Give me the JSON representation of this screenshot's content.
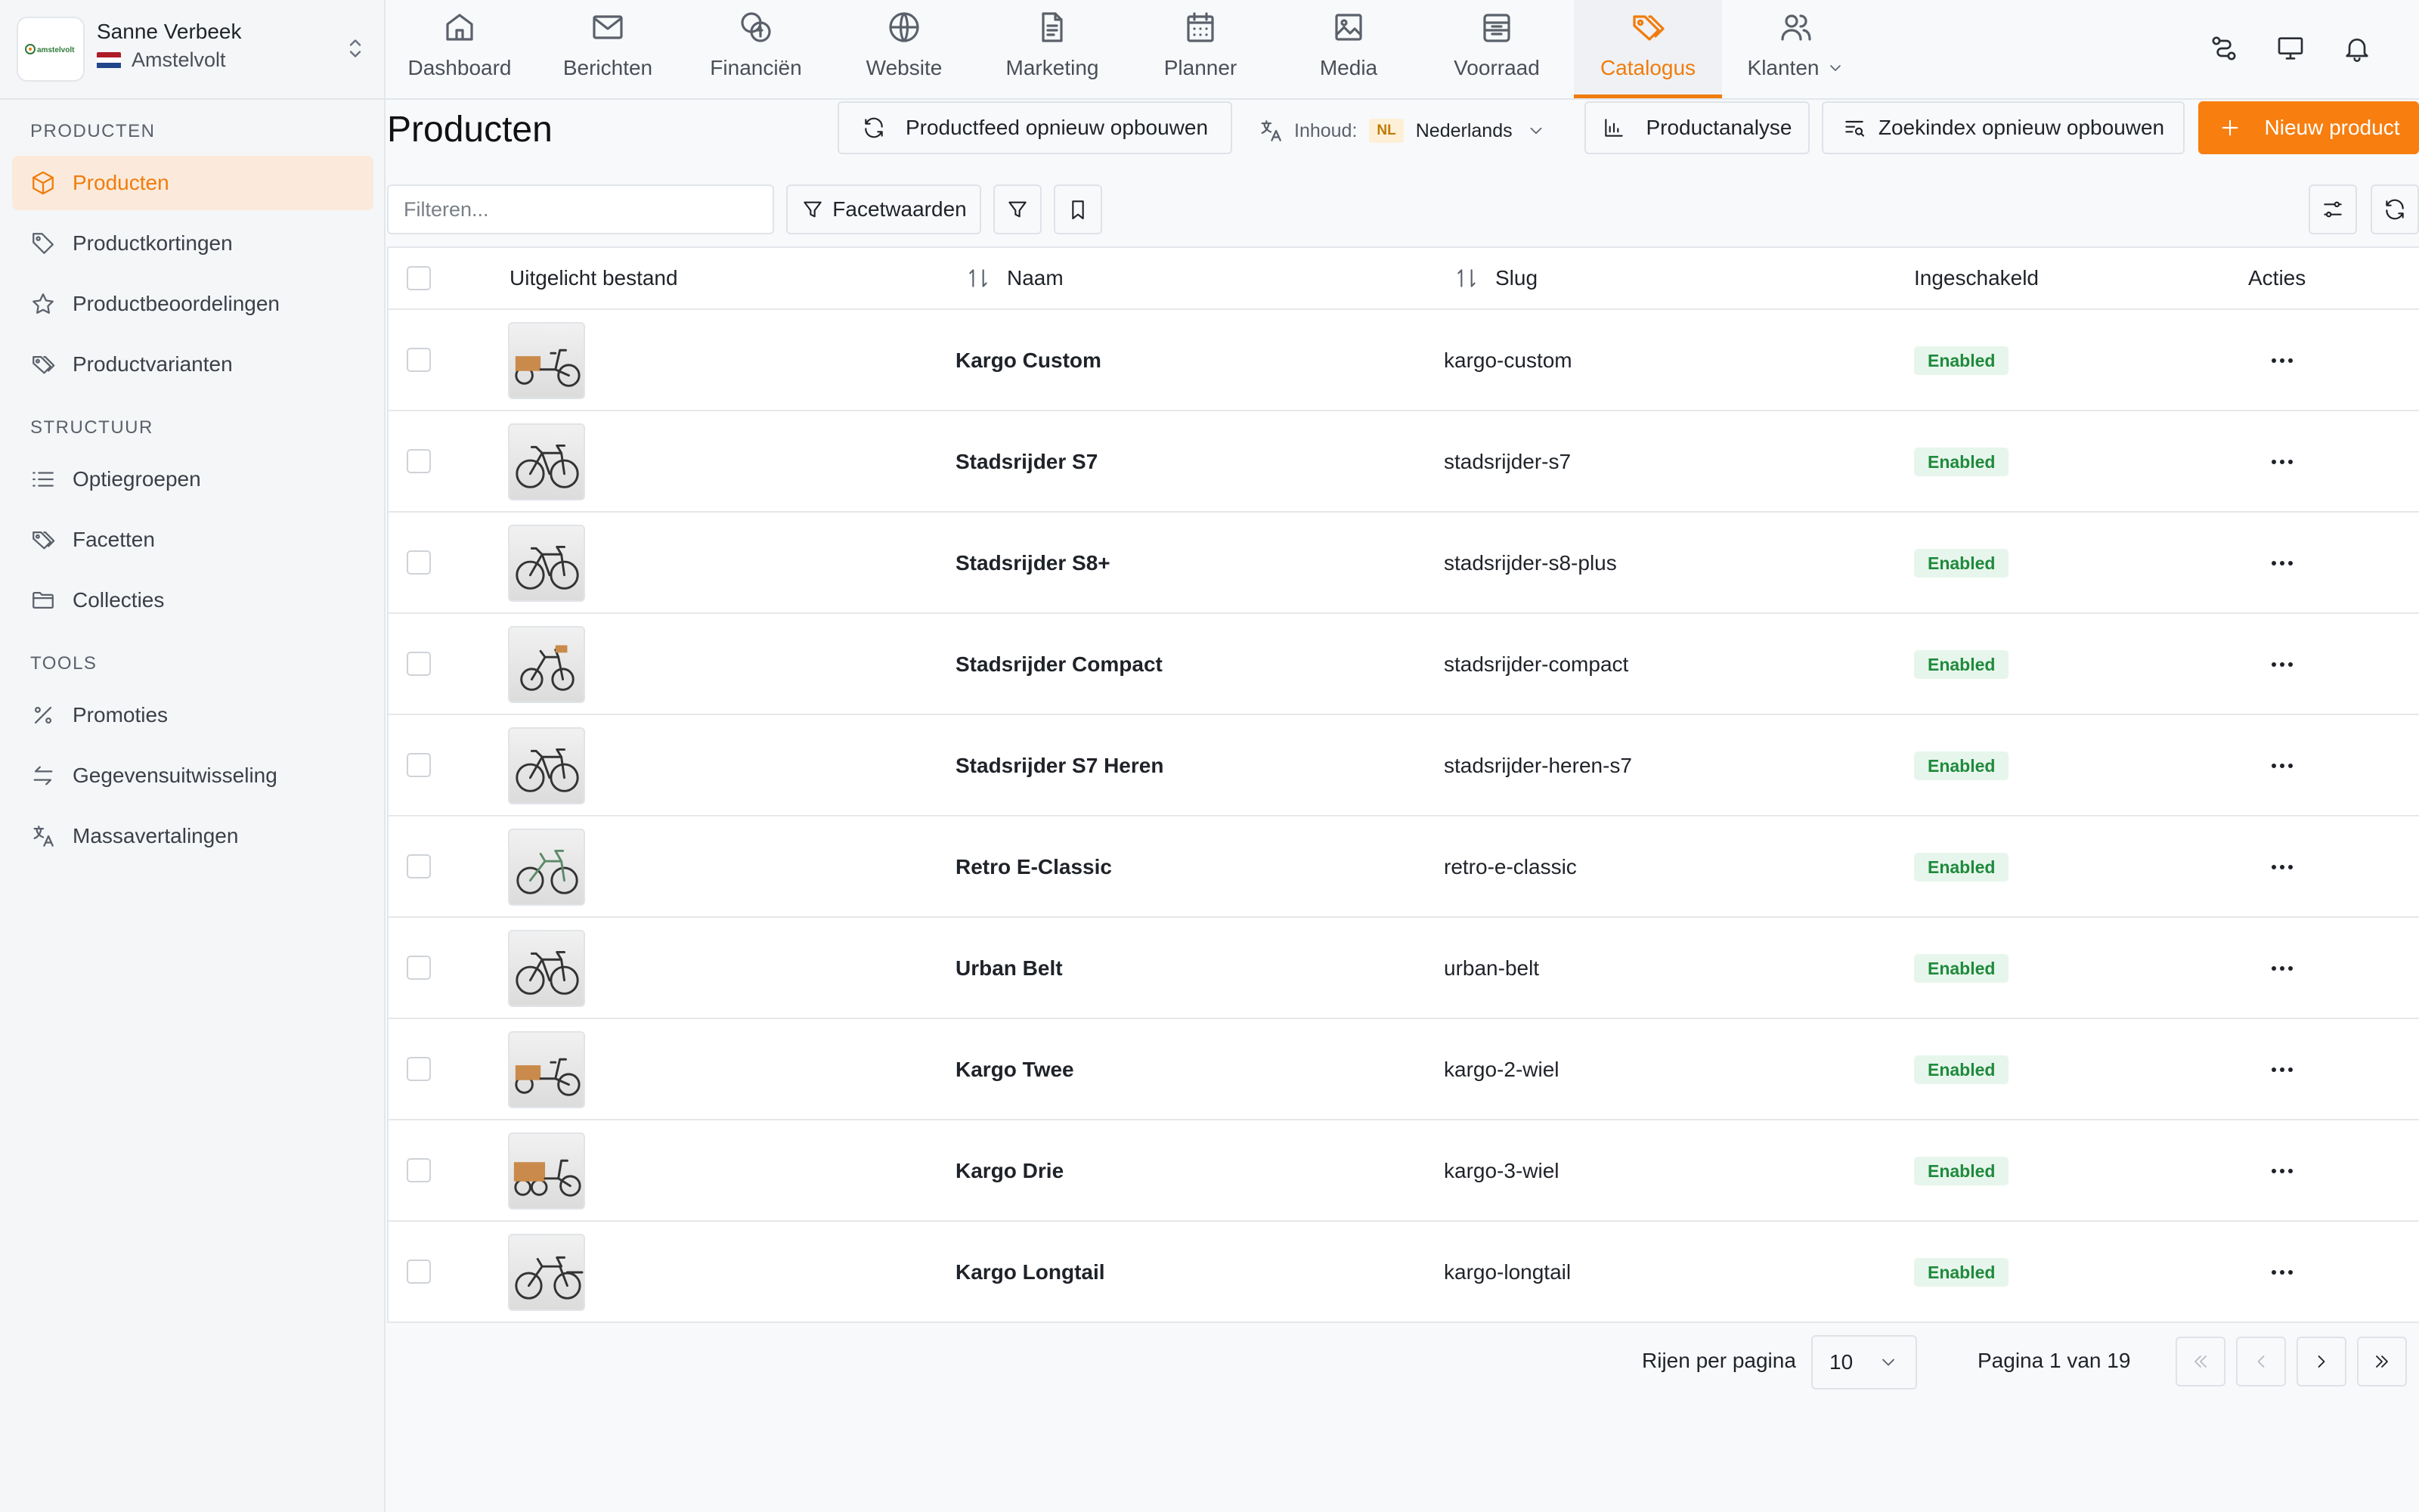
{
  "account": {
    "name": "Sanne Verbeek",
    "shop": "Amstelvolt",
    "logo_text": "amstelvolt"
  },
  "sidebar": {
    "sections": [
      {
        "title": "PRODUCTEN",
        "items": [
          {
            "label": "Producten",
            "icon": "cube-icon",
            "active": true
          },
          {
            "label": "Productkortingen",
            "icon": "tag-icon"
          },
          {
            "label": "Productbeoordelingen",
            "icon": "star-icon"
          },
          {
            "label": "Productvarianten",
            "icon": "tags-icon"
          }
        ]
      },
      {
        "title": "STRUCTUUR",
        "items": [
          {
            "label": "Optiegroepen",
            "icon": "list-icon"
          },
          {
            "label": "Facetten",
            "icon": "tags-icon"
          },
          {
            "label": "Collecties",
            "icon": "folder-icon"
          }
        ]
      },
      {
        "title": "TOOLS",
        "items": [
          {
            "label": "Promoties",
            "icon": "percent-icon"
          },
          {
            "label": "Gegevensuitwisseling",
            "icon": "arrows-exchange-icon"
          },
          {
            "label": "Massavertalingen",
            "icon": "translate-icon"
          }
        ]
      }
    ]
  },
  "topnav": {
    "tabs": [
      {
        "label": "Dashboard",
        "icon": "home-icon"
      },
      {
        "label": "Berichten",
        "icon": "mail-icon"
      },
      {
        "label": "Financiën",
        "icon": "coins-icon"
      },
      {
        "label": "Website",
        "icon": "globe-icon"
      },
      {
        "label": "Marketing",
        "icon": "document-icon"
      },
      {
        "label": "Planner",
        "icon": "calendar-icon"
      },
      {
        "label": "Media",
        "icon": "image-icon"
      },
      {
        "label": "Voorraad",
        "icon": "archive-icon"
      },
      {
        "label": "Catalogus",
        "icon": "tags-icon",
        "active": true
      },
      {
        "label": "Klanten",
        "icon": "users-icon",
        "dropdown": true
      }
    ]
  },
  "page": {
    "title": "Producten"
  },
  "header_actions": {
    "rebuild_feed": "Productfeed opnieuw opbouwen",
    "content_label": "Inhoud:",
    "lang_code": "NL",
    "lang_name": "Nederlands",
    "analysis": "Productanalyse",
    "rebuild_index": "Zoekindex opnieuw opbouwen",
    "new_product": "Nieuw product"
  },
  "toolbar": {
    "filter_placeholder": "Filteren...",
    "facets": "Facetwaarden"
  },
  "table": {
    "columns": {
      "image": "Uitgelicht bestand",
      "name": "Naam",
      "slug": "Slug",
      "enabled": "Ingeschakeld",
      "actions": "Acties"
    },
    "rows": [
      {
        "name": "Kargo Custom",
        "slug": "kargo-custom",
        "status": "Enabled",
        "bike": "cargo"
      },
      {
        "name": "Stadsrijder S7",
        "slug": "stadsrijder-s7",
        "status": "Enabled",
        "bike": "city"
      },
      {
        "name": "Stadsrijder S8+",
        "slug": "stadsrijder-s8-plus",
        "status": "Enabled",
        "bike": "city"
      },
      {
        "name": "Stadsrijder Compact",
        "slug": "stadsrijder-compact",
        "status": "Enabled",
        "bike": "compact"
      },
      {
        "name": "Stadsrijder S7 Heren",
        "slug": "stadsrijder-heren-s7",
        "status": "Enabled",
        "bike": "city"
      },
      {
        "name": "Retro E-Classic",
        "slug": "retro-e-classic",
        "status": "Enabled",
        "bike": "retro"
      },
      {
        "name": "Urban Belt",
        "slug": "urban-belt",
        "status": "Enabled",
        "bike": "city"
      },
      {
        "name": "Kargo Twee",
        "slug": "kargo-2-wiel",
        "status": "Enabled",
        "bike": "cargo"
      },
      {
        "name": "Kargo Drie",
        "slug": "kargo-3-wiel",
        "status": "Enabled",
        "bike": "trike"
      },
      {
        "name": "Kargo Longtail",
        "slug": "kargo-longtail",
        "status": "Enabled",
        "bike": "longtail"
      }
    ]
  },
  "pagination": {
    "rows_label": "Rijen per pagina",
    "rows_value": "10",
    "page_info": "Pagina 1 van 19"
  },
  "colors": {
    "accent": "#f77e0f",
    "active_bg": "#fbeadb",
    "enabled_bg": "#e7f6ec",
    "enabled_text": "#1f8a3c"
  }
}
